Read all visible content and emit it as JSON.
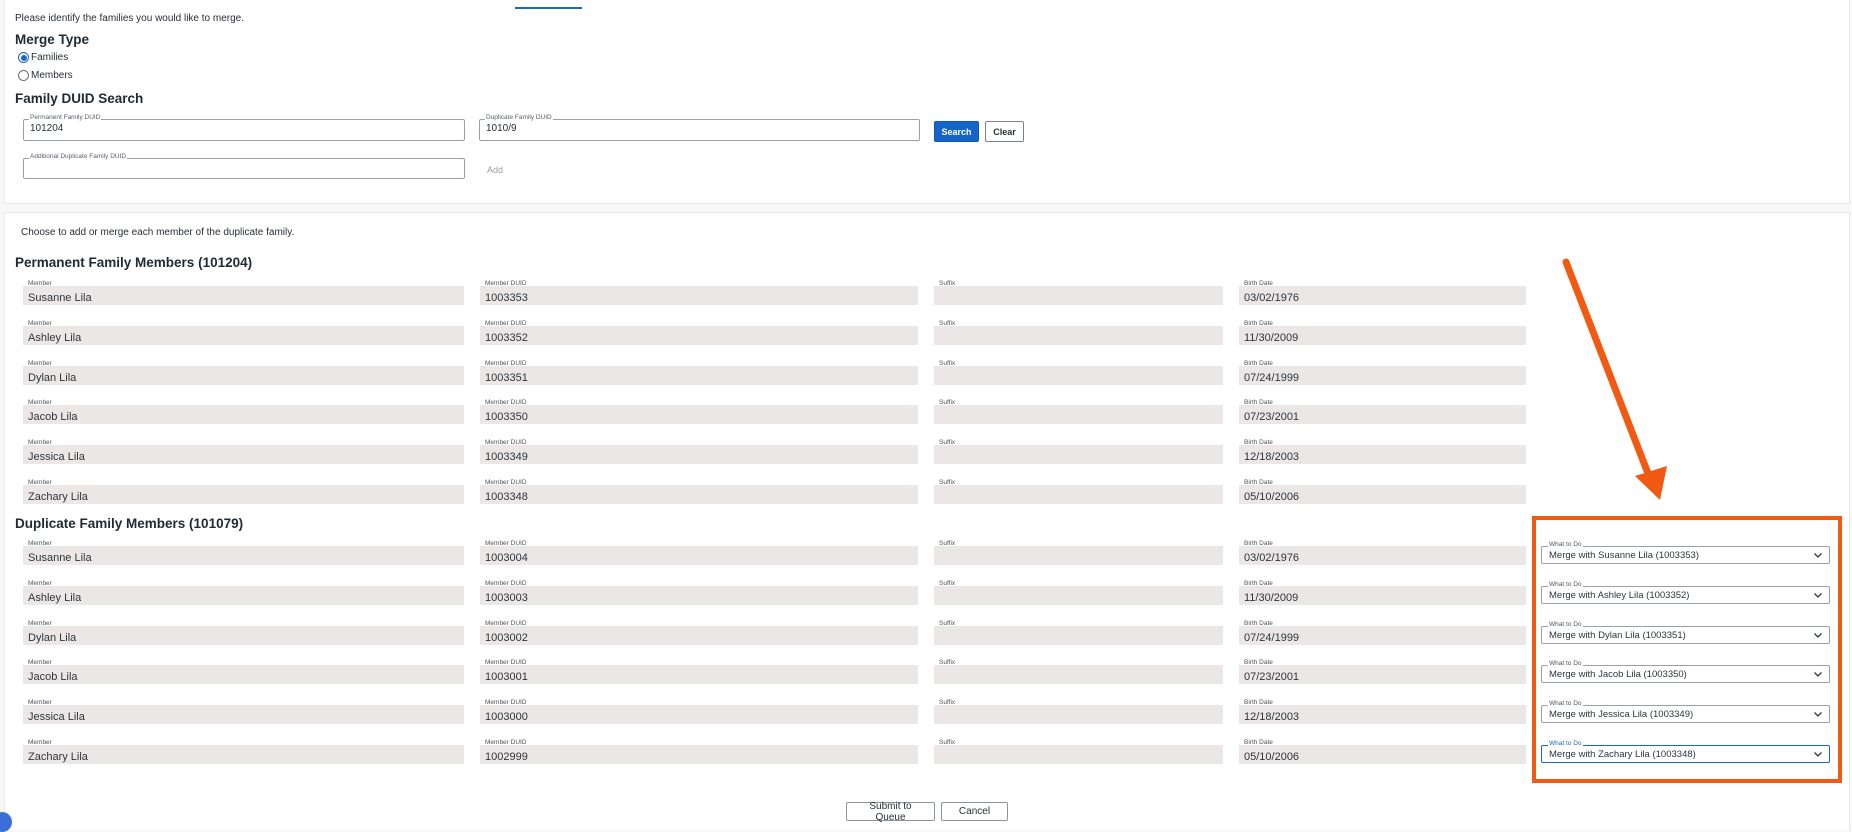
{
  "intro_text": "Please identify the families you would like to merge.",
  "merge_type": {
    "title": "Merge Type",
    "options": [
      {
        "label": "Families",
        "selected": true
      },
      {
        "label": "Members",
        "selected": false
      }
    ]
  },
  "search": {
    "title": "Family DUID Search",
    "permanent_label": "Permanent Family DUID",
    "permanent_value": "101204",
    "duplicate_label": "Duplicate Family DUID",
    "duplicate_value": "1010/9",
    "additional_label": "Additional Duplicate Family DUID",
    "additional_value": "",
    "search_button": "Search",
    "clear_button": "Clear",
    "add_link": "Add"
  },
  "choose_text": "Choose to add or merge each member of the duplicate family.",
  "column_labels": {
    "member": "Member",
    "duid": "Member DUID",
    "suffix": "Suffix",
    "birth": "Birth Date",
    "what": "What to Do"
  },
  "permanent": {
    "title": "Permanent Family Members (101204)",
    "rows": [
      {
        "name": "Susanne Lila",
        "duid": "1003353",
        "suffix": "",
        "birth": "03/02/1976"
      },
      {
        "name": "Ashley Lila",
        "duid": "1003352",
        "suffix": "",
        "birth": "11/30/2009"
      },
      {
        "name": "Dylan Lila",
        "duid": "1003351",
        "suffix": "",
        "birth": "07/24/1999"
      },
      {
        "name": "Jacob Lila",
        "duid": "1003350",
        "suffix": "",
        "birth": "07/23/2001"
      },
      {
        "name": "Jessica Lila",
        "duid": "1003349",
        "suffix": "",
        "birth": "12/18/2003"
      },
      {
        "name": "Zachary Lila",
        "duid": "1003348",
        "suffix": "",
        "birth": "05/10/2006"
      }
    ]
  },
  "duplicate": {
    "title": "Duplicate Family Members (101079)",
    "rows": [
      {
        "name": "Susanne Lila",
        "duid": "1003004",
        "suffix": "",
        "birth": "03/02/1976",
        "action": "Merge with Susanne Lila (1003353)"
      },
      {
        "name": "Ashley Lila",
        "duid": "1003003",
        "suffix": "",
        "birth": "11/30/2009",
        "action": "Merge with Ashley Lila (1003352)"
      },
      {
        "name": "Dylan Lila",
        "duid": "1003002",
        "suffix": "",
        "birth": "07/24/1999",
        "action": "Merge with Dylan Lila (1003351)"
      },
      {
        "name": "Jacob Lila",
        "duid": "1003001",
        "suffix": "",
        "birth": "07/23/2001",
        "action": "Merge with Jacob Lila (1003350)"
      },
      {
        "name": "Jessica Lila",
        "duid": "1003000",
        "suffix": "",
        "birth": "12/18/2003",
        "action": "Merge with Jessica Lila (1003349)"
      },
      {
        "name": "Zachary Lila",
        "duid": "1002999",
        "suffix": "",
        "birth": "05/10/2006",
        "action": "Merge with Zachary Lila (1003348)"
      }
    ]
  },
  "footer": {
    "submit_button": "Submit to Queue",
    "cancel_button": "Cancel"
  },
  "colors": {
    "accent": "#1a66c9",
    "annotation": "#f15a12",
    "readonly_bg": "#ebe7e7"
  },
  "icons": {
    "select_chevron": "chevron-down-icon",
    "annotation_arrow": "arrow-down-icon"
  }
}
